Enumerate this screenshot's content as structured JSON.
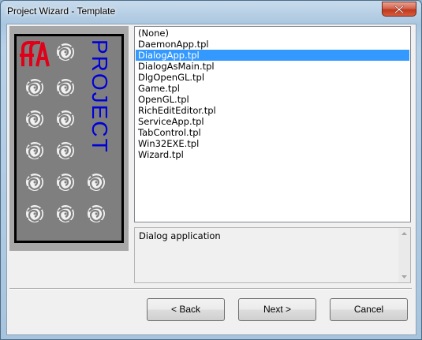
{
  "window": {
    "title": "Project Wizard - Template"
  },
  "logo": {
    "letters": "PROJECT",
    "mark": "ffA",
    "text_color": "#0000d8",
    "mark_color": "#e0001a"
  },
  "templates": {
    "items": [
      {
        "label": "(None)"
      },
      {
        "label": "DaemonApp.tpl"
      },
      {
        "label": "DialogApp.tpl",
        "selected": true
      },
      {
        "label": "DialogAsMain.tpl"
      },
      {
        "label": "DlgOpenGL.tpl"
      },
      {
        "label": "Game.tpl"
      },
      {
        "label": "OpenGL.tpl"
      },
      {
        "label": "RichEditEditor.tpl"
      },
      {
        "label": "ServiceApp.tpl"
      },
      {
        "label": "TabControl.tpl"
      },
      {
        "label": "Win32EXE.tpl"
      },
      {
        "label": "Wizard.tpl"
      }
    ],
    "selected_color": "#3399ff"
  },
  "description": {
    "text": "Dialog application"
  },
  "buttons": {
    "back": "< Back",
    "next": "Next >",
    "cancel": "Cancel"
  },
  "icons": {
    "close": "close-icon",
    "scroll_up": "scroll-up-arrow-icon",
    "scroll_down": "scroll-down-arrow-icon"
  }
}
